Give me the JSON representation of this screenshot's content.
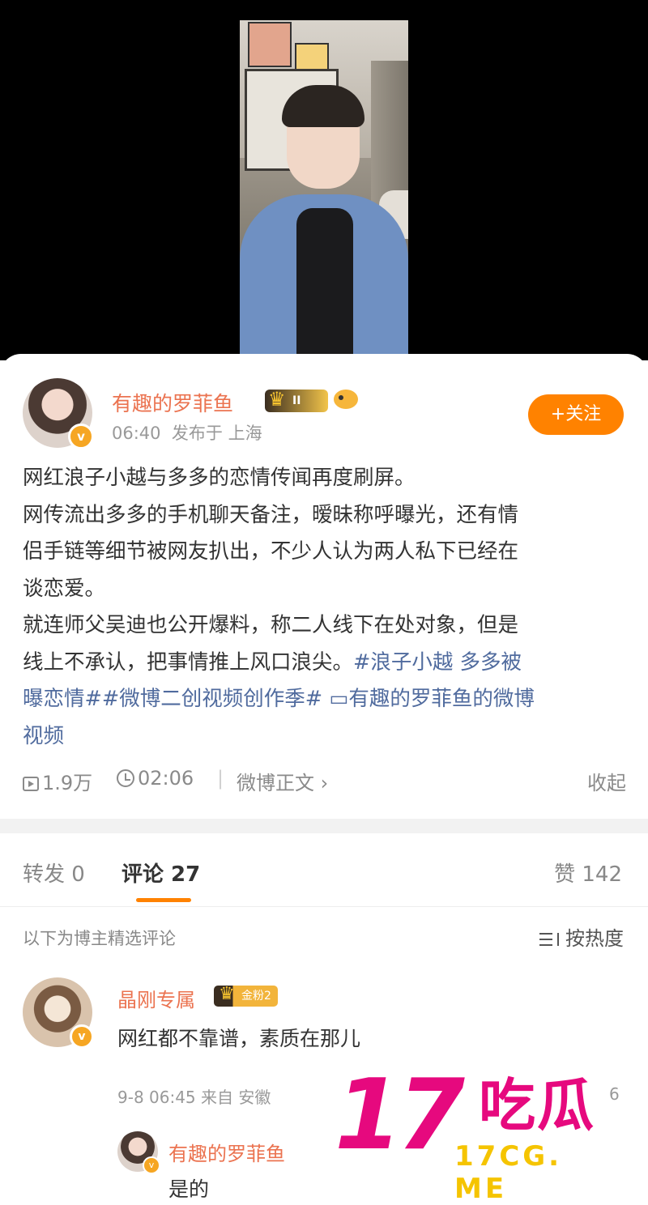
{
  "post": {
    "author": "有趣的罗菲鱼",
    "level_badge": "II",
    "time": "06:40",
    "location": "发布于 上海",
    "follow_label": "+关注",
    "body_lines": [
      "网红浪子小越与多多的恋情传闻再度刷屏。",
      "网传流出多多的手机聊天备注，暧昧称呼曝光，还有情",
      "侣手链等细节被网友扒出，不少人认为两人私下已经在",
      "谈恋爱。",
      "就连师父吴迪也公开爆料，称二人线下在处对象，但是",
      "线上不承认，把事情推上风口浪尖。"
    ],
    "hashtag1_a": "#浪子小越 多多被",
    "hashtag1_b": "曝恋情#",
    "hashtag2": "#微博二创视频创作季#",
    "video_link_a": "有趣的罗菲鱼的微博",
    "video_link_b": "视频",
    "plays": "1.9万",
    "duration": "02:06",
    "weibo_text_link": "微博正文",
    "collapse_label": "收起"
  },
  "tabs": {
    "repost": "转发 0",
    "comments": "评论 27",
    "likes": "赞 142"
  },
  "filter": {
    "label": "以下为博主精选评论",
    "sort_label": "按热度"
  },
  "comments": [
    {
      "name": "晶刚专属",
      "badge": "金粉2",
      "text": "网红都不靠谱，素质在那儿",
      "meta": "9-8 06:45 来自 安徽",
      "reply_count": "6"
    }
  ],
  "reply": {
    "name": "有趣的罗菲鱼",
    "text": "是的"
  },
  "watermark": {
    "main": "17",
    "cn": "吃瓜",
    "sub": "17CG. ME"
  },
  "colors": {
    "accent": "#ff8200",
    "name": "#eb7350",
    "link": "#506b9e",
    "watermark": "#e6097e"
  }
}
